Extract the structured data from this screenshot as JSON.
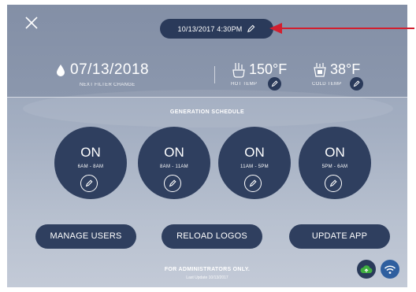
{
  "colors": {
    "panel_dark": "#2f3f5f",
    "pill": "#2a3a5a",
    "annotation_arrow": "#d21f2f",
    "cloud_green": "#3fae3f",
    "wifi_blue": "#2f5f9f"
  },
  "header": {
    "close_icon": "close-icon",
    "datetime": "10/13/2017 4:30PM",
    "datetime_edit_icon": "pencil-icon"
  },
  "status": {
    "filter": {
      "icon": "water-drop-icon",
      "date": "07/13/2018",
      "label": "NEXT FILTER CHANGE"
    },
    "hot": {
      "icon": "hot-tap-icon",
      "value": "150°F",
      "label": "HOT TEMP"
    },
    "cold": {
      "icon": "cold-cup-icon",
      "value": "38°F",
      "label": "COLD TEMP"
    }
  },
  "schedule": {
    "title": "GENERATION SCHEDULE",
    "slots": [
      {
        "state": "ON",
        "range": "6AM - 8AM"
      },
      {
        "state": "ON",
        "range": "8AM - 11AM"
      },
      {
        "state": "ON",
        "range": "11AM - 5PM"
      },
      {
        "state": "ON",
        "range": "5PM - 6AM"
      }
    ]
  },
  "actions": {
    "manage_users": "MANAGE USERS",
    "reload_logos": "RELOAD LOGOS",
    "update_app": "UPDATE APP"
  },
  "footer": {
    "admin_note": "FOR ADMINISTRATORS ONLY.",
    "last_update": "Last Update 10/13/2017",
    "cloud_icon": "cloud-upload-icon",
    "wifi_icon": "wifi-icon"
  }
}
